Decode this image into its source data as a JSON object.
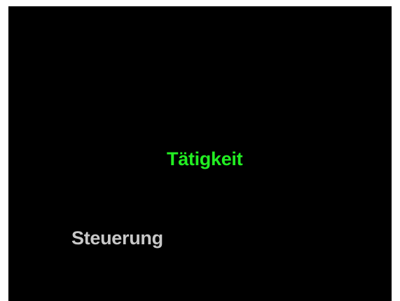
{
  "menu": {
    "items": [
      {
        "label": "Tätigkeit",
        "selected": true
      },
      {
        "label": "Steuerung",
        "selected": false
      }
    ]
  },
  "colors": {
    "background": "#000000",
    "frame": "#ffffff",
    "selected_text": "#22ee22",
    "unselected_text": "#c8c8c8"
  }
}
